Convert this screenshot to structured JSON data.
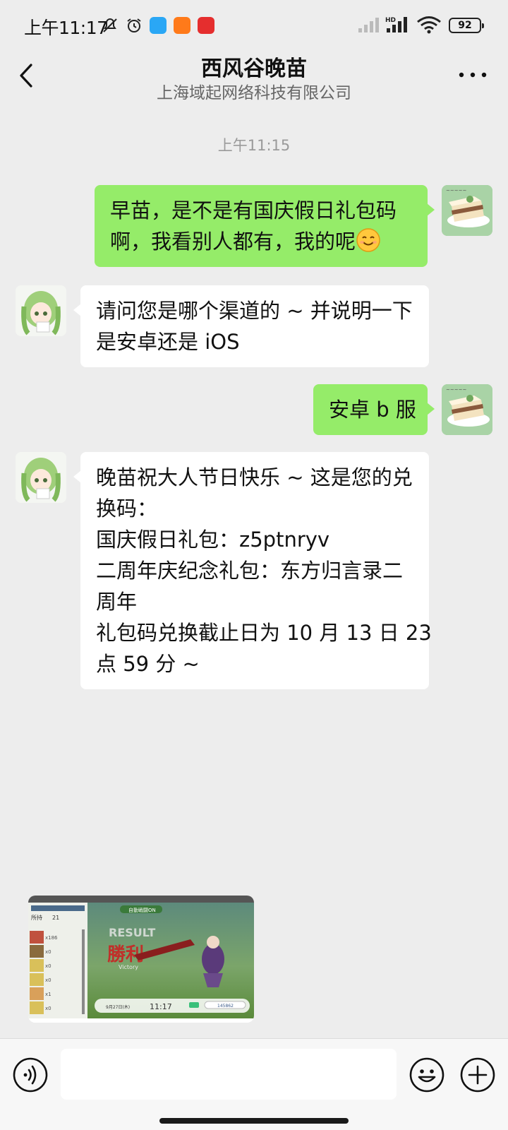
{
  "status_bar": {
    "time": "上午11:17",
    "battery": "92",
    "network_label": "HD"
  },
  "header": {
    "title": "西风谷晚苗",
    "subtitle": "上海域起网络科技有限公司"
  },
  "chat": {
    "timestamp": "上午11:15",
    "messages": [
      {
        "direction": "out",
        "lines": [
          "早苗，是不是有国庆假日礼包码",
          "啊，我看别人都有，我的呢"
        ],
        "emoji": "smiling-face"
      },
      {
        "direction": "in",
        "lines": [
          "请问您是哪个渠道的 ~ 并说明一下",
          "是安卓还是 iOS"
        ]
      },
      {
        "direction": "out",
        "lines": [
          "安卓 b 服"
        ]
      },
      {
        "direction": "in",
        "lines": [
          "晚苗祝大人节日快乐 ~ 这是您的兑",
          "换码：",
          "国庆假日礼包：z5ptnryv",
          "二周年庆纪念礼包：东方归言录二",
          "周年",
          "礼包码兑换截止日为 10 月 13 日 23",
          "点 59 分 ~"
        ]
      }
    ]
  },
  "thumbnail": {
    "game_title_badge": "自動戦闘ON",
    "result_text": "RESULT",
    "victory_text": "勝利",
    "victory_sub": "Victory",
    "time": "11:17",
    "date": "9月27日(木)",
    "score": "145862",
    "currency_count": "21",
    "item_counts": [
      "x186",
      "x0",
      "x0",
      "x0",
      "x1",
      "x0"
    ]
  },
  "input": {
    "placeholder": ""
  },
  "colors": {
    "bubble_out": "#95ec69",
    "bubble_in": "#ffffff",
    "background": "#ededed"
  }
}
